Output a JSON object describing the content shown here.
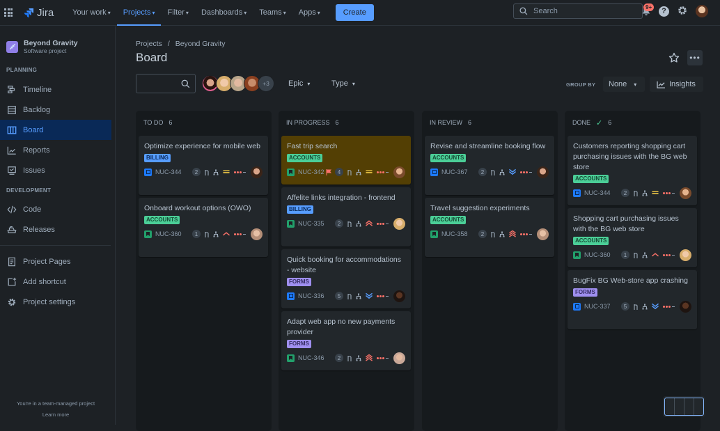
{
  "topbar": {
    "app_name": "Jira",
    "nav": [
      {
        "label": "Your work",
        "active": false
      },
      {
        "label": "Projects",
        "active": true
      },
      {
        "label": "Filter",
        "active": false
      },
      {
        "label": "Dashboards",
        "active": false
      },
      {
        "label": "Teams",
        "active": false
      },
      {
        "label": "Apps",
        "active": false
      }
    ],
    "create_label": "Create",
    "search_placeholder": "Search",
    "notifications_badge": "9+",
    "help_glyph": "?",
    "icons": [
      "app-switcher-icon",
      "jira-logo-icon",
      "search-icon",
      "bell-icon",
      "help-icon",
      "settings-icon",
      "user-avatar"
    ]
  },
  "sidebar": {
    "project_name": "Beyond Gravity",
    "project_type": "Software project",
    "sections": [
      {
        "label": "PLANNING",
        "items": [
          {
            "label": "Timeline",
            "icon": "timeline-icon"
          },
          {
            "label": "Backlog",
            "icon": "backlog-icon"
          },
          {
            "label": "Board",
            "icon": "board-icon",
            "active": true
          },
          {
            "label": "Reports",
            "icon": "reports-icon"
          },
          {
            "label": "Issues",
            "icon": "issues-icon"
          }
        ]
      },
      {
        "label": "DEVELOPMENT",
        "items": [
          {
            "label": "Code",
            "icon": "code-icon"
          },
          {
            "label": "Releases",
            "icon": "releases-icon"
          }
        ]
      }
    ],
    "extra_items": [
      {
        "label": "Project Pages",
        "icon": "page-icon"
      },
      {
        "label": "Add shortcut",
        "icon": "add-shortcut-icon"
      },
      {
        "label": "Project settings",
        "icon": "settings-icon"
      }
    ],
    "footer_text": "You're in a team-managed project",
    "footer_link": "Learn more"
  },
  "main": {
    "breadcrumb": [
      "Projects",
      "Beyond Gravity"
    ],
    "breadcrumb_sep": "/",
    "title": "Board",
    "more_glyph": "•••",
    "board_search_value": "",
    "more_assignees": "+3",
    "filters": [
      {
        "label": "Epic"
      },
      {
        "label": "Type"
      }
    ],
    "group_by_label": "GROUP BY",
    "group_by_value": "None",
    "insights_label": "Insights",
    "chevron_glyph": "⌄"
  },
  "colors": {
    "accent": "#579dff",
    "billing": "#579dff",
    "accounts": "#4bce97",
    "forms": "#9f8fef",
    "flagged_card": "#533f04",
    "priority_high": "#f87168",
    "priority_medium": "#f5cd47",
    "priority_low": "#579dff"
  },
  "columns": [
    {
      "name": "TO DO",
      "count": "6",
      "done": false,
      "cards": [
        {
          "title": "Optimize experience for mobile web",
          "label": "BILLING",
          "type": "task",
          "key": "NUC-344",
          "estimate": "2",
          "priority": "medium",
          "flagged": false
        },
        {
          "title": "Onboard workout options (OWO)",
          "label": "ACCOUNTS",
          "type": "story",
          "key": "NUC-360",
          "estimate": "1",
          "priority": "high",
          "flagged": false
        }
      ]
    },
    {
      "name": "IN PROGRESS",
      "count": "6",
      "done": false,
      "cards": [
        {
          "title": "Fast trip search",
          "label": "ACCOUNTS",
          "type": "story",
          "key": "NUC-342",
          "estimate": "4",
          "priority": "medium",
          "flagged": true
        },
        {
          "title": "Affelite links integration - frontend",
          "label": "BILLING",
          "type": "story",
          "key": "NUC-335",
          "estimate": "2",
          "priority": "highest",
          "flagged": false
        },
        {
          "title": "Quick booking for accommodations - website",
          "label": "FORMS",
          "type": "task",
          "key": "NUC-336",
          "estimate": "5",
          "priority": "lowest",
          "flagged": false
        },
        {
          "title": "Adapt web app no new payments provider",
          "label": "FORMS",
          "type": "story",
          "key": "NUC-346",
          "estimate": "2",
          "priority": "critical",
          "flagged": false
        }
      ]
    },
    {
      "name": "IN REVIEW",
      "count": "6",
      "done": false,
      "cards": [
        {
          "title": "Revise and streamline booking flow",
          "label": "ACCOUNTS",
          "type": "task",
          "key": "NUC-367",
          "estimate": "2",
          "priority": "lowest",
          "flagged": false
        },
        {
          "title": "Travel suggestion experiments",
          "label": "ACCOUNTS",
          "type": "story",
          "key": "NUC-358",
          "estimate": "2",
          "priority": "critical",
          "flagged": false
        }
      ]
    },
    {
      "name": "DONE",
      "count": "6",
      "done": true,
      "cards": [
        {
          "title": "Customers reporting shopping cart purchasing issues with the BG web store",
          "label": "ACCOUNTS",
          "type": "task",
          "key": "NUC-344",
          "estimate": "2",
          "priority": "medium",
          "flagged": false
        },
        {
          "title": "Shopping cart purchasing issues with the BG web store",
          "label": "ACCOUNTS",
          "type": "story",
          "key": "NUC-360",
          "estimate": "1",
          "priority": "high",
          "flagged": false
        },
        {
          "title": "BugFix BG Web-store app crashing",
          "label": "FORMS",
          "type": "task",
          "key": "NUC-337",
          "estimate": "5",
          "priority": "lowest",
          "flagged": false
        }
      ]
    }
  ]
}
